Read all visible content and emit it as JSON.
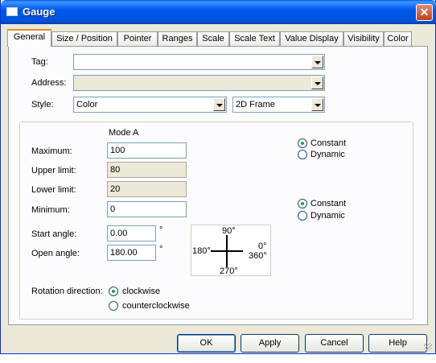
{
  "window": {
    "title": "Gauge",
    "close_glyph": "✕"
  },
  "tabs": [
    {
      "label": "General",
      "active": true
    },
    {
      "label": "Size / Position"
    },
    {
      "label": "Pointer"
    },
    {
      "label": "Ranges"
    },
    {
      "label": "Scale"
    },
    {
      "label": "Scale Text"
    },
    {
      "label": "Value Display"
    },
    {
      "label": "Visibility"
    },
    {
      "label": "Color"
    }
  ],
  "general": {
    "tag_label": "Tag:",
    "tag_value": "",
    "address_label": "Address:",
    "address_value": "",
    "style_label": "Style:",
    "style_value": "Color",
    "frame_value": "2D Frame"
  },
  "mode": {
    "heading": "Mode A",
    "maximum_label": "Maximum:",
    "maximum_value": "100",
    "upper_label": "Upper limit:",
    "upper_value": "80",
    "lower_label": "Lower limit:",
    "lower_value": "20",
    "minimum_label": "Minimum:",
    "minimum_value": "0",
    "start_label": "Start angle:",
    "start_value": "0.00",
    "open_label": "Open angle:",
    "open_value": "180.00",
    "degree_symbol": "°"
  },
  "max_mode": {
    "constant": "Constant",
    "dynamic": "Dynamic",
    "selected": "Constant"
  },
  "min_mode": {
    "constant": "Constant",
    "dynamic": "Dynamic",
    "selected": "Constant"
  },
  "dial": {
    "top": "90°",
    "left": "180°",
    "right_top": "0°",
    "right_bottom": "360°",
    "bottom": "270°"
  },
  "rotation": {
    "label": "Rotation direction:",
    "clockwise": "clockwise",
    "counterclockwise": "counterclockwise",
    "selected": "clockwise"
  },
  "buttons": {
    "ok": "OK",
    "apply": "Apply",
    "cancel": "Cancel",
    "help": "Help"
  }
}
